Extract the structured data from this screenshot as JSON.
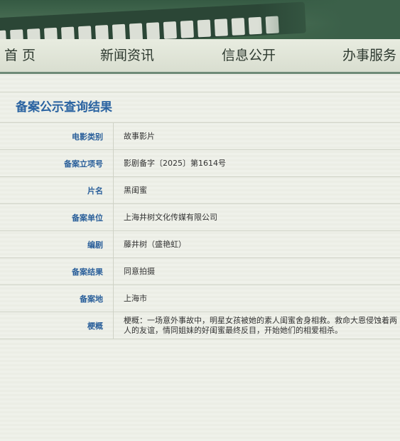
{
  "nav": {
    "items": [
      "首 页",
      "新闻资讯",
      "信息公开",
      "办事服务"
    ]
  },
  "page": {
    "title": "备案公示查询结果"
  },
  "record": {
    "rows": [
      {
        "label": "电影类别",
        "value": "故事影片"
      },
      {
        "label": "备案立项号",
        "value": "影剧备字〔2025〕第1614号"
      },
      {
        "label": "片名",
        "value": "黑闺蜜"
      },
      {
        "label": "备案单位",
        "value": "上海井树文化传媒有限公司"
      },
      {
        "label": "编剧",
        "value": "藤井树（盛艳虹）"
      },
      {
        "label": "备案结果",
        "value": "同意拍摄"
      },
      {
        "label": "备案地",
        "value": "上海市"
      },
      {
        "label": "梗概",
        "value": "梗概：一场意外事故中，明星女孩被她的素人闺蜜舍身相救。救命大恩侵蚀着两人的友谊，情同姐妹的好闺蜜最终反目，开始她们的相爱相杀。"
      }
    ]
  },
  "colors": {
    "accent": "#2a63a1",
    "banner": "#355a43",
    "nav_border": "#6f8a77"
  }
}
